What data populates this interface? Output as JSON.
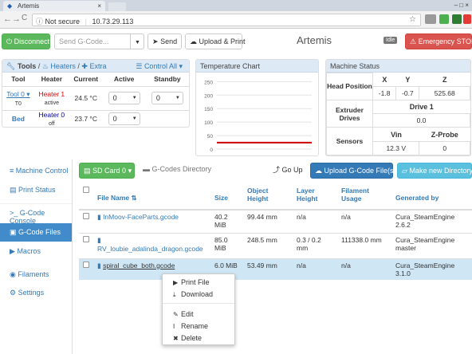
{
  "browser": {
    "tab_title": "Artemis",
    "tab_close": "×",
    "window_buttons": "–  □  ×",
    "back": "←",
    "forward": "→",
    "reload": "C",
    "security": "Not secure",
    "url": "10.73.29.113",
    "star": "☆",
    "menu": "⋮",
    "ext_colors": [
      "#9a9a9a",
      "#4caf50",
      "#2e7d32",
      "#e53935"
    ]
  },
  "header": {
    "disconnect_label": "Disconnect",
    "gcode_placeholder": "Send G-Code...",
    "send_label": "Send",
    "upload_print_label": "Upload & Print",
    "title": "Artemis",
    "status_badge": "Idle",
    "estop_label": "Emergency STOP"
  },
  "tools_panel": {
    "tools_label": "Tools",
    "heaters_label": "Heaters",
    "extra_label": "Extra",
    "control_all_label": "Control All",
    "columns": [
      "Tool",
      "Heater",
      "Current",
      "Active",
      "Standby"
    ],
    "tool0": {
      "name": "Tool 0",
      "sub": "T0",
      "heater": "Heater 1",
      "heater_state": "active",
      "current": "24.5 °C",
      "active": "0",
      "standby": "0"
    },
    "bed": {
      "name": "Bed",
      "heater": "Heater 0",
      "heater_state": "off",
      "current": "23.7 °C",
      "active": "0"
    }
  },
  "temp_chart": {
    "title": "Temperature Chart",
    "chart_data": {
      "type": "line",
      "title": "",
      "xlabel": "",
      "ylabel": "",
      "yticks": [
        0,
        50,
        100,
        150,
        200,
        250
      ],
      "ylim": [
        0,
        260
      ],
      "series": [
        {
          "color": "#cc0000",
          "values": [
            24,
            24
          ]
        }
      ]
    }
  },
  "machine_status": {
    "title": "Machine Status",
    "head_position_label": "Head Position",
    "axes": [
      "X",
      "Y",
      "Z"
    ],
    "position": [
      "-1.8",
      "-0.7",
      "525.68"
    ],
    "extruder_label": "Extruder Drives",
    "drive_label": "Drive 1",
    "drive_value": "0.0",
    "sensors_label": "Sensors",
    "vin_label": "Vin",
    "vin_value": "12.3 V",
    "zprobe_label": "Z-Probe",
    "zprobe_value": "0"
  },
  "sidebar": {
    "items": [
      {
        "label": "Machine Control",
        "icon": "≡"
      },
      {
        "label": "Print Status",
        "icon": "▤"
      },
      {
        "label": "G-Code Console",
        "icon": ">_"
      },
      {
        "label": "G-Code Files",
        "icon": "▣"
      },
      {
        "label": "Macros",
        "icon": "▶"
      },
      {
        "label": "Filaments",
        "icon": "◉"
      },
      {
        "label": "Settings",
        "icon": "⚙"
      }
    ]
  },
  "files": {
    "sd_card_label": "SD Card 0",
    "directory_label": "G-Codes Directory",
    "go_up_label": "Go Up",
    "upload_label": "Upload G-Code File(s)",
    "new_dir_label": "Make new Directory",
    "columns": [
      "File Name",
      "Size",
      "Object Height",
      "Layer Height",
      "Filament Usage",
      "Generated by"
    ],
    "rows": [
      {
        "name": "InMoov-FaceParts.gcode",
        "size": "40.2 MiB",
        "object_height": "99.44 mm",
        "layer_height": "n/a",
        "filament": "n/a",
        "generator": "Cura_SteamEngine 2.6.2"
      },
      {
        "name": "RV_loubie_adalinda_dragon.gcode",
        "size": "85.0 MiB",
        "object_height": "248.5 mm",
        "layer_height": "0.3 / 0.2 mm",
        "filament": "111338.0 mm",
        "generator": "Cura_SteamEngine master"
      },
      {
        "name": "spiral_cube_both.gcode",
        "size": "6.0 MiB",
        "object_height": "53.49 mm",
        "layer_height": "n/a",
        "filament": "n/a",
        "generator": "Cura_SteamEngine 3.1.0"
      }
    ]
  },
  "context_menu": {
    "items": [
      "Print File",
      "Download",
      "Edit",
      "Rename",
      "Delete"
    ]
  }
}
